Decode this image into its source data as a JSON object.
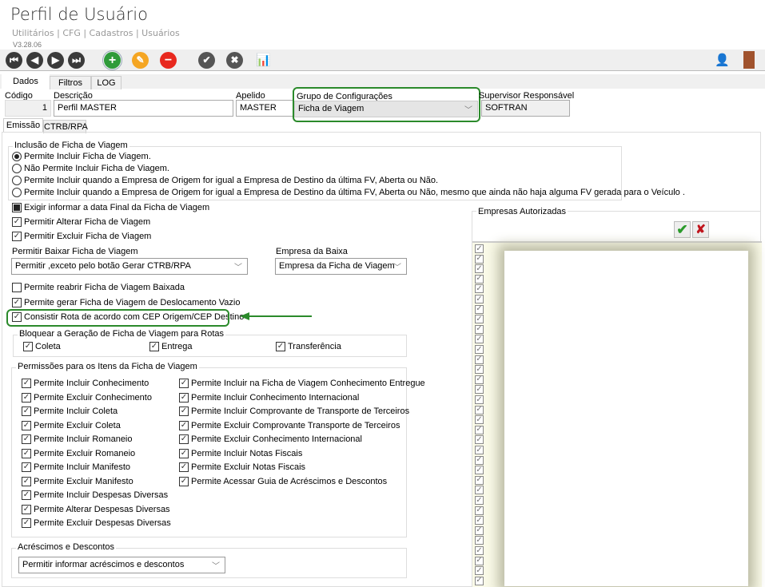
{
  "header": {
    "title": "Perfil de Usuário",
    "breadcrumb": "Utilitários | CFG | Cadastros | Usuários",
    "version": "V3.28.06"
  },
  "toolbar": {
    "buttons": [
      "first-icon",
      "previous-icon",
      "next-icon",
      "last-icon",
      "add-icon",
      "edit-icon",
      "delete-icon",
      "confirm-icon",
      "cancel-icon",
      "report-settings-icon",
      "user-security-icon",
      "exit-door-icon"
    ]
  },
  "tabs": [
    "Dados",
    "Filtros",
    "LOG"
  ],
  "form": {
    "codigo_label": "Código",
    "codigo": "1",
    "descricao_label": "Descrição",
    "descricao": "Perfil MASTER",
    "apelido_label": "Apelido",
    "apelido": "MASTER",
    "grupo_label": "Grupo de Configurações",
    "grupo": "Ficha de Viagem",
    "supervisor_label": "Supervisor Responsável",
    "supervisor": "SOFTRAN"
  },
  "subtabs": [
    "Emissão",
    "CTRB/RPA"
  ],
  "inclusao": {
    "title": "Inclusão de Ficha de Viagem",
    "selected": 0,
    "options": [
      "Permite Incluir Ficha de Viagem.",
      "Não Permite Incluir Ficha de Viagem.",
      "Permite Incluir quando a Empresa de Origem for igual a Empresa de Destino da última FV, Aberta ou Não.",
      "Permite Incluir quando a Empresa de Origem for igual a Empresa de Destino da última FV, Aberta ou Não, mesmo que ainda não haja alguma FV gerada para o Veículo ."
    ]
  },
  "checks1": [
    {
      "label": "Exigir informar a data Final da Ficha de Viagem",
      "state": "indeterminate"
    },
    {
      "label": "Permitir Alterar Ficha de Viagem",
      "state": "checked"
    },
    {
      "label": "Permitir Excluir Ficha de Viagem",
      "state": "checked"
    }
  ],
  "baixar": {
    "label": "Permitir Baixar Ficha de Viagem",
    "value": "Permitir ,exceto pelo botão Gerar CTRB/RPA"
  },
  "empresa_baixa": {
    "label": "Empresa da Baixa",
    "value": "Empresa da Ficha de Viagem"
  },
  "checks2": [
    {
      "label": "Permite reabrir Ficha de Viagem Baixada",
      "state": "unchecked"
    },
    {
      "label": "Permite gerar Ficha de Viagem de Deslocamento Vazio",
      "state": "checked"
    },
    {
      "label": "Consistir Rota de acordo com CEP Origem/CEP Destino",
      "state": "checked"
    }
  ],
  "bloquear": {
    "title": "Bloquear a Geração de Ficha de Viagem para Rotas",
    "items": [
      "Coleta",
      "Entrega",
      "Transferência"
    ]
  },
  "permissoes": {
    "title": "Permissões para os Itens da Ficha de Viagem",
    "col1": [
      "Permite Incluir Conhecimento",
      "Permite Excluir Conhecimento",
      "Permite Incluir Coleta",
      "Permite Excluir Coleta",
      "Permite Incluir Romaneio",
      "Permite Excluir Romaneio",
      "Permite Incluir Manifesto",
      "Permite Excluir Manifesto",
      "Permite Incluir Despesas Diversas",
      "Permite Alterar Despesas Diversas",
      "Permite Excluir Despesas Diversas"
    ],
    "col2": [
      "Permite Incluir na Ficha de Viagem Conhecimento Entregue",
      "Permite Incluir Conhecimento Internacional",
      "Permite Incluir Comprovante de Transporte de Terceiros",
      "Permite Excluir Comprovante Transporte de Terceiros",
      "Permite Excluir Conhecimento Internacional",
      "Permite Incluir Notas Fiscais",
      "Permite Excluir Notas Fiscais",
      "Permite Acessar Guia de Acréscimos e Descontos"
    ]
  },
  "acrescimos": {
    "title": "Acréscimos e Descontos",
    "value": "Permitir informar acréscimos e descontos"
  },
  "empresas": {
    "title": "Empresas Autorizadas",
    "select_all_icon": "green-check-icon",
    "clear_icon": "red-x-icon"
  },
  "colors": {
    "highlight": "#2b8a2b",
    "add": "#2e9b3a",
    "edit": "#f5a623",
    "delete": "#e8281e",
    "nav": "#3a3a3a"
  }
}
